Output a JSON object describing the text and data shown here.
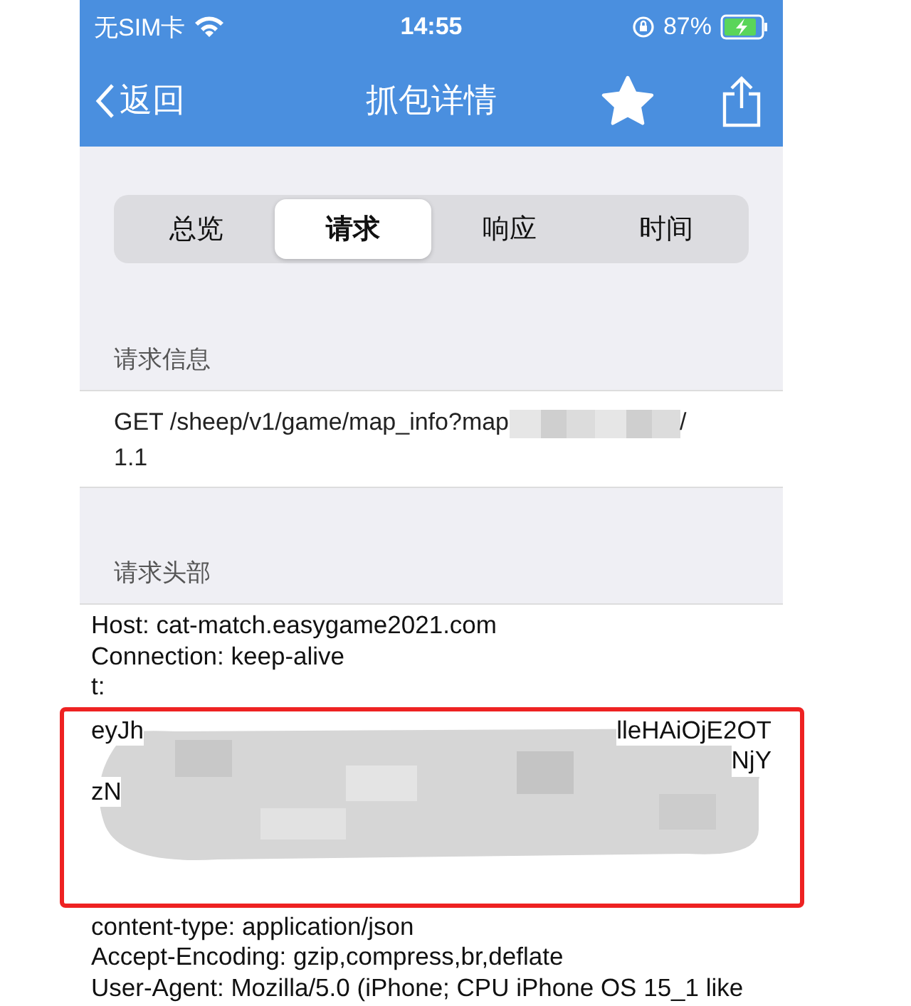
{
  "status_bar": {
    "carrier": "无SIM卡",
    "time": "14:55",
    "battery": "87%"
  },
  "nav_bar": {
    "back": "返回",
    "title": "抓包详情"
  },
  "tabs": [
    {
      "label": "总览",
      "selected": false
    },
    {
      "label": "请求",
      "selected": true
    },
    {
      "label": "响应",
      "selected": false
    },
    {
      "label": "时间",
      "selected": false
    }
  ],
  "request_info": {
    "heading": "请求信息",
    "line_start": "GET /sheep/v1/game/map_info?map",
    "line_end": "/",
    "line_2": "1.1"
  },
  "request_headers": {
    "heading": "请求头部",
    "lines": [
      {
        "kind": "plain",
        "text": "Host: cat-match.easygame2021.com"
      },
      {
        "kind": "plain",
        "text": "Connection: keep-alive"
      },
      {
        "kind": "plain",
        "text": "t:"
      },
      {
        "kind": "redacted",
        "left": "eyJh",
        "right": "lleHAiOjE2OT"
      },
      {
        "kind": "redacted",
        "right": "NjY"
      },
      {
        "kind": "redacted",
        "left": "zN"
      },
      {
        "kind": "redacted"
      },
      {
        "kind": "redacted"
      },
      {
        "kind": "redacted"
      },
      {
        "kind": "plain",
        "text": "content-type: application/json"
      },
      {
        "kind": "plain",
        "text": "Accept-Encoding: gzip,compress,br,deflate"
      },
      {
        "kind": "plain",
        "text": "User-Agent: Mozilla/5.0 (iPhone; CPU iPhone OS 15_1 like"
      }
    ]
  }
}
